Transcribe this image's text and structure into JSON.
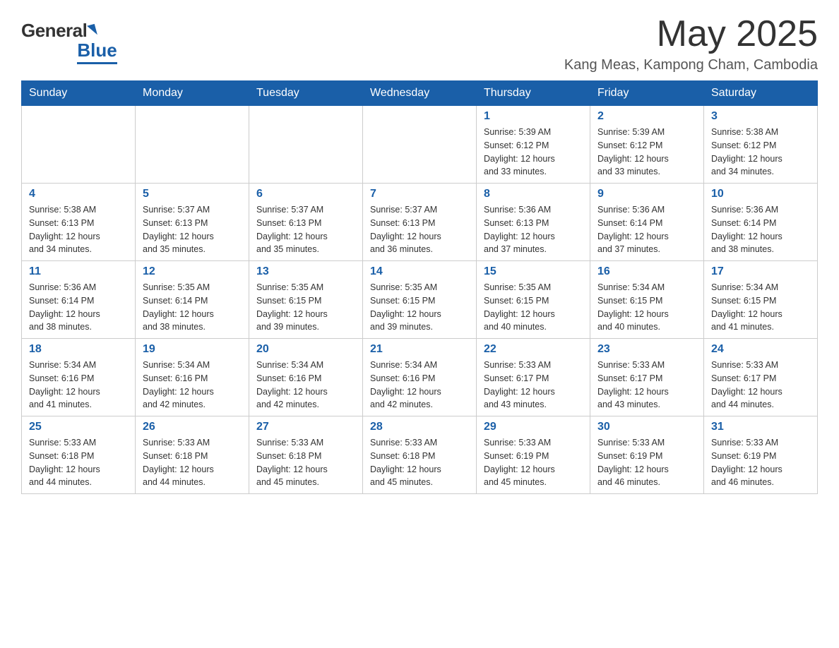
{
  "header": {
    "logo_general": "General",
    "logo_blue": "Blue",
    "month_title": "May 2025",
    "location": "Kang Meas, Kampong Cham, Cambodia"
  },
  "days_of_week": [
    "Sunday",
    "Monday",
    "Tuesday",
    "Wednesday",
    "Thursday",
    "Friday",
    "Saturday"
  ],
  "weeks": [
    [
      {
        "day": "",
        "info": ""
      },
      {
        "day": "",
        "info": ""
      },
      {
        "day": "",
        "info": ""
      },
      {
        "day": "",
        "info": ""
      },
      {
        "day": "1",
        "info": "Sunrise: 5:39 AM\nSunset: 6:12 PM\nDaylight: 12 hours\nand 33 minutes."
      },
      {
        "day": "2",
        "info": "Sunrise: 5:39 AM\nSunset: 6:12 PM\nDaylight: 12 hours\nand 33 minutes."
      },
      {
        "day": "3",
        "info": "Sunrise: 5:38 AM\nSunset: 6:12 PM\nDaylight: 12 hours\nand 34 minutes."
      }
    ],
    [
      {
        "day": "4",
        "info": "Sunrise: 5:38 AM\nSunset: 6:13 PM\nDaylight: 12 hours\nand 34 minutes."
      },
      {
        "day": "5",
        "info": "Sunrise: 5:37 AM\nSunset: 6:13 PM\nDaylight: 12 hours\nand 35 minutes."
      },
      {
        "day": "6",
        "info": "Sunrise: 5:37 AM\nSunset: 6:13 PM\nDaylight: 12 hours\nand 35 minutes."
      },
      {
        "day": "7",
        "info": "Sunrise: 5:37 AM\nSunset: 6:13 PM\nDaylight: 12 hours\nand 36 minutes."
      },
      {
        "day": "8",
        "info": "Sunrise: 5:36 AM\nSunset: 6:13 PM\nDaylight: 12 hours\nand 37 minutes."
      },
      {
        "day": "9",
        "info": "Sunrise: 5:36 AM\nSunset: 6:14 PM\nDaylight: 12 hours\nand 37 minutes."
      },
      {
        "day": "10",
        "info": "Sunrise: 5:36 AM\nSunset: 6:14 PM\nDaylight: 12 hours\nand 38 minutes."
      }
    ],
    [
      {
        "day": "11",
        "info": "Sunrise: 5:36 AM\nSunset: 6:14 PM\nDaylight: 12 hours\nand 38 minutes."
      },
      {
        "day": "12",
        "info": "Sunrise: 5:35 AM\nSunset: 6:14 PM\nDaylight: 12 hours\nand 38 minutes."
      },
      {
        "day": "13",
        "info": "Sunrise: 5:35 AM\nSunset: 6:15 PM\nDaylight: 12 hours\nand 39 minutes."
      },
      {
        "day": "14",
        "info": "Sunrise: 5:35 AM\nSunset: 6:15 PM\nDaylight: 12 hours\nand 39 minutes."
      },
      {
        "day": "15",
        "info": "Sunrise: 5:35 AM\nSunset: 6:15 PM\nDaylight: 12 hours\nand 40 minutes."
      },
      {
        "day": "16",
        "info": "Sunrise: 5:34 AM\nSunset: 6:15 PM\nDaylight: 12 hours\nand 40 minutes."
      },
      {
        "day": "17",
        "info": "Sunrise: 5:34 AM\nSunset: 6:15 PM\nDaylight: 12 hours\nand 41 minutes."
      }
    ],
    [
      {
        "day": "18",
        "info": "Sunrise: 5:34 AM\nSunset: 6:16 PM\nDaylight: 12 hours\nand 41 minutes."
      },
      {
        "day": "19",
        "info": "Sunrise: 5:34 AM\nSunset: 6:16 PM\nDaylight: 12 hours\nand 42 minutes."
      },
      {
        "day": "20",
        "info": "Sunrise: 5:34 AM\nSunset: 6:16 PM\nDaylight: 12 hours\nand 42 minutes."
      },
      {
        "day": "21",
        "info": "Sunrise: 5:34 AM\nSunset: 6:16 PM\nDaylight: 12 hours\nand 42 minutes."
      },
      {
        "day": "22",
        "info": "Sunrise: 5:33 AM\nSunset: 6:17 PM\nDaylight: 12 hours\nand 43 minutes."
      },
      {
        "day": "23",
        "info": "Sunrise: 5:33 AM\nSunset: 6:17 PM\nDaylight: 12 hours\nand 43 minutes."
      },
      {
        "day": "24",
        "info": "Sunrise: 5:33 AM\nSunset: 6:17 PM\nDaylight: 12 hours\nand 44 minutes."
      }
    ],
    [
      {
        "day": "25",
        "info": "Sunrise: 5:33 AM\nSunset: 6:18 PM\nDaylight: 12 hours\nand 44 minutes."
      },
      {
        "day": "26",
        "info": "Sunrise: 5:33 AM\nSunset: 6:18 PM\nDaylight: 12 hours\nand 44 minutes."
      },
      {
        "day": "27",
        "info": "Sunrise: 5:33 AM\nSunset: 6:18 PM\nDaylight: 12 hours\nand 45 minutes."
      },
      {
        "day": "28",
        "info": "Sunrise: 5:33 AM\nSunset: 6:18 PM\nDaylight: 12 hours\nand 45 minutes."
      },
      {
        "day": "29",
        "info": "Sunrise: 5:33 AM\nSunset: 6:19 PM\nDaylight: 12 hours\nand 45 minutes."
      },
      {
        "day": "30",
        "info": "Sunrise: 5:33 AM\nSunset: 6:19 PM\nDaylight: 12 hours\nand 46 minutes."
      },
      {
        "day": "31",
        "info": "Sunrise: 5:33 AM\nSunset: 6:19 PM\nDaylight: 12 hours\nand 46 minutes."
      }
    ]
  ]
}
